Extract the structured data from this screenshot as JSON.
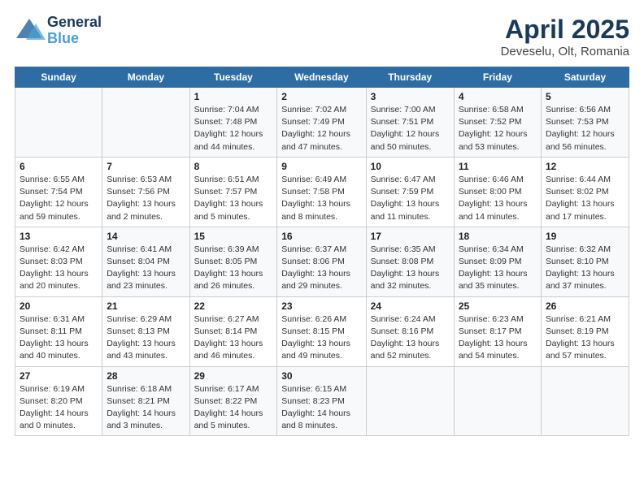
{
  "logo": {
    "line1": "General",
    "line2": "Blue"
  },
  "title": "April 2025",
  "subtitle": "Deveselu, Olt, Romania",
  "weekdays": [
    "Sunday",
    "Monday",
    "Tuesday",
    "Wednesday",
    "Thursday",
    "Friday",
    "Saturday"
  ],
  "weeks": [
    [
      {
        "day": "",
        "sunrise": "",
        "sunset": "",
        "daylight": ""
      },
      {
        "day": "",
        "sunrise": "",
        "sunset": "",
        "daylight": ""
      },
      {
        "day": "1",
        "sunrise": "Sunrise: 7:04 AM",
        "sunset": "Sunset: 7:48 PM",
        "daylight": "Daylight: 12 hours and 44 minutes."
      },
      {
        "day": "2",
        "sunrise": "Sunrise: 7:02 AM",
        "sunset": "Sunset: 7:49 PM",
        "daylight": "Daylight: 12 hours and 47 minutes."
      },
      {
        "day": "3",
        "sunrise": "Sunrise: 7:00 AM",
        "sunset": "Sunset: 7:51 PM",
        "daylight": "Daylight: 12 hours and 50 minutes."
      },
      {
        "day": "4",
        "sunrise": "Sunrise: 6:58 AM",
        "sunset": "Sunset: 7:52 PM",
        "daylight": "Daylight: 12 hours and 53 minutes."
      },
      {
        "day": "5",
        "sunrise": "Sunrise: 6:56 AM",
        "sunset": "Sunset: 7:53 PM",
        "daylight": "Daylight: 12 hours and 56 minutes."
      }
    ],
    [
      {
        "day": "6",
        "sunrise": "Sunrise: 6:55 AM",
        "sunset": "Sunset: 7:54 PM",
        "daylight": "Daylight: 12 hours and 59 minutes."
      },
      {
        "day": "7",
        "sunrise": "Sunrise: 6:53 AM",
        "sunset": "Sunset: 7:56 PM",
        "daylight": "Daylight: 13 hours and 2 minutes."
      },
      {
        "day": "8",
        "sunrise": "Sunrise: 6:51 AM",
        "sunset": "Sunset: 7:57 PM",
        "daylight": "Daylight: 13 hours and 5 minutes."
      },
      {
        "day": "9",
        "sunrise": "Sunrise: 6:49 AM",
        "sunset": "Sunset: 7:58 PM",
        "daylight": "Daylight: 13 hours and 8 minutes."
      },
      {
        "day": "10",
        "sunrise": "Sunrise: 6:47 AM",
        "sunset": "Sunset: 7:59 PM",
        "daylight": "Daylight: 13 hours and 11 minutes."
      },
      {
        "day": "11",
        "sunrise": "Sunrise: 6:46 AM",
        "sunset": "Sunset: 8:00 PM",
        "daylight": "Daylight: 13 hours and 14 minutes."
      },
      {
        "day": "12",
        "sunrise": "Sunrise: 6:44 AM",
        "sunset": "Sunset: 8:02 PM",
        "daylight": "Daylight: 13 hours and 17 minutes."
      }
    ],
    [
      {
        "day": "13",
        "sunrise": "Sunrise: 6:42 AM",
        "sunset": "Sunset: 8:03 PM",
        "daylight": "Daylight: 13 hours and 20 minutes."
      },
      {
        "day": "14",
        "sunrise": "Sunrise: 6:41 AM",
        "sunset": "Sunset: 8:04 PM",
        "daylight": "Daylight: 13 hours and 23 minutes."
      },
      {
        "day": "15",
        "sunrise": "Sunrise: 6:39 AM",
        "sunset": "Sunset: 8:05 PM",
        "daylight": "Daylight: 13 hours and 26 minutes."
      },
      {
        "day": "16",
        "sunrise": "Sunrise: 6:37 AM",
        "sunset": "Sunset: 8:06 PM",
        "daylight": "Daylight: 13 hours and 29 minutes."
      },
      {
        "day": "17",
        "sunrise": "Sunrise: 6:35 AM",
        "sunset": "Sunset: 8:08 PM",
        "daylight": "Daylight: 13 hours and 32 minutes."
      },
      {
        "day": "18",
        "sunrise": "Sunrise: 6:34 AM",
        "sunset": "Sunset: 8:09 PM",
        "daylight": "Daylight: 13 hours and 35 minutes."
      },
      {
        "day": "19",
        "sunrise": "Sunrise: 6:32 AM",
        "sunset": "Sunset: 8:10 PM",
        "daylight": "Daylight: 13 hours and 37 minutes."
      }
    ],
    [
      {
        "day": "20",
        "sunrise": "Sunrise: 6:31 AM",
        "sunset": "Sunset: 8:11 PM",
        "daylight": "Daylight: 13 hours and 40 minutes."
      },
      {
        "day": "21",
        "sunrise": "Sunrise: 6:29 AM",
        "sunset": "Sunset: 8:13 PM",
        "daylight": "Daylight: 13 hours and 43 minutes."
      },
      {
        "day": "22",
        "sunrise": "Sunrise: 6:27 AM",
        "sunset": "Sunset: 8:14 PM",
        "daylight": "Daylight: 13 hours and 46 minutes."
      },
      {
        "day": "23",
        "sunrise": "Sunrise: 6:26 AM",
        "sunset": "Sunset: 8:15 PM",
        "daylight": "Daylight: 13 hours and 49 minutes."
      },
      {
        "day": "24",
        "sunrise": "Sunrise: 6:24 AM",
        "sunset": "Sunset: 8:16 PM",
        "daylight": "Daylight: 13 hours and 52 minutes."
      },
      {
        "day": "25",
        "sunrise": "Sunrise: 6:23 AM",
        "sunset": "Sunset: 8:17 PM",
        "daylight": "Daylight: 13 hours and 54 minutes."
      },
      {
        "day": "26",
        "sunrise": "Sunrise: 6:21 AM",
        "sunset": "Sunset: 8:19 PM",
        "daylight": "Daylight: 13 hours and 57 minutes."
      }
    ],
    [
      {
        "day": "27",
        "sunrise": "Sunrise: 6:19 AM",
        "sunset": "Sunset: 8:20 PM",
        "daylight": "Daylight: 14 hours and 0 minutes."
      },
      {
        "day": "28",
        "sunrise": "Sunrise: 6:18 AM",
        "sunset": "Sunset: 8:21 PM",
        "daylight": "Daylight: 14 hours and 3 minutes."
      },
      {
        "day": "29",
        "sunrise": "Sunrise: 6:17 AM",
        "sunset": "Sunset: 8:22 PM",
        "daylight": "Daylight: 14 hours and 5 minutes."
      },
      {
        "day": "30",
        "sunrise": "Sunrise: 6:15 AM",
        "sunset": "Sunset: 8:23 PM",
        "daylight": "Daylight: 14 hours and 8 minutes."
      },
      {
        "day": "",
        "sunrise": "",
        "sunset": "",
        "daylight": ""
      },
      {
        "day": "",
        "sunrise": "",
        "sunset": "",
        "daylight": ""
      },
      {
        "day": "",
        "sunrise": "",
        "sunset": "",
        "daylight": ""
      }
    ]
  ]
}
